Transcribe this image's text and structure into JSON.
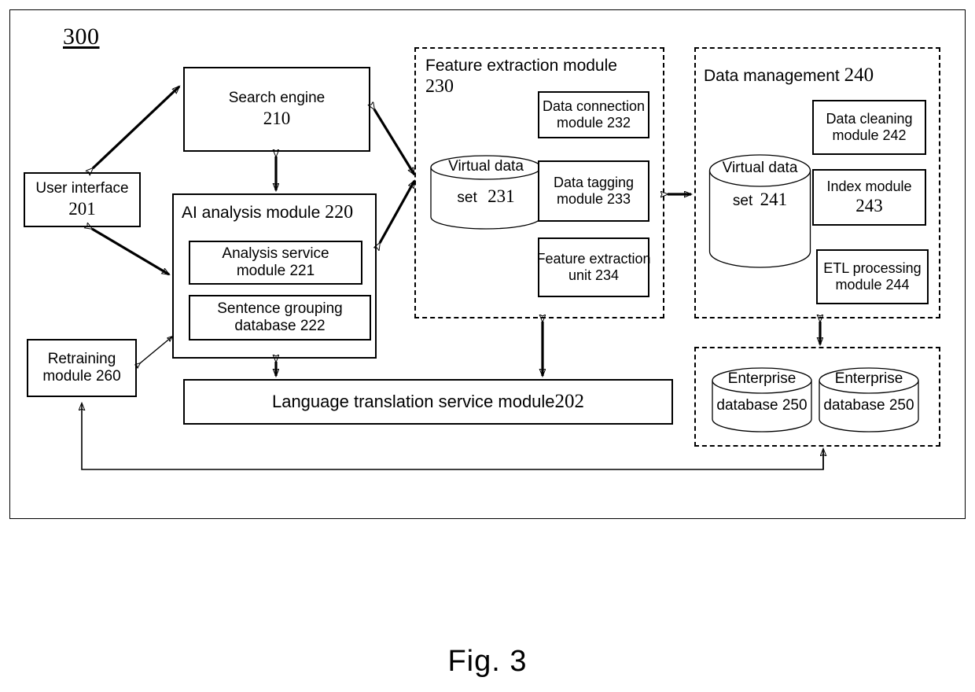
{
  "figure": {
    "id_label": "300",
    "caption": "Fig. 3"
  },
  "blocks": {
    "search_engine": {
      "label": "Search engine",
      "number": "210"
    },
    "user_interface": {
      "label": "User interface",
      "number": "201"
    },
    "ai_analysis": {
      "title": "AI analysis module",
      "number": "220",
      "children": [
        {
          "label_line1": "Analysis service",
          "label_line2": "module 221"
        },
        {
          "label_line1": "Sentence grouping",
          "label_line2": "database 222"
        }
      ]
    },
    "retraining": {
      "label": "Retraining",
      "number": "module 260"
    },
    "language_translation": {
      "label": "Language translation service module",
      "number": "202"
    }
  },
  "groups": {
    "feature_extraction": {
      "title": "Feature extraction module",
      "number": "230",
      "cylinder": {
        "line1": "Virtual data",
        "line2": "set",
        "number": "231"
      },
      "units": [
        {
          "line1": "Data connection",
          "line2": "module 232"
        },
        {
          "line1": "Data tagging",
          "line2": "module 233"
        },
        {
          "line1": "Feature extraction",
          "line2": "unit 234"
        }
      ]
    },
    "data_management": {
      "title": "Data management",
      "number": "240",
      "cylinder": {
        "line1": "Virtual data",
        "line2": "set",
        "number": "241"
      },
      "units": [
        {
          "line1": "Data cleaning",
          "line2": "module 242"
        },
        {
          "line1": "Index module",
          "line2": "243"
        },
        {
          "line1": "ETL processing",
          "line2": "module 244"
        }
      ]
    },
    "enterprise": {
      "databases": [
        {
          "line1": "Enterprise",
          "line2": "database 250"
        },
        {
          "line1": "Enterprise",
          "line2": "database 250"
        }
      ]
    }
  },
  "colors": {
    "stroke": "#000000",
    "background": "#ffffff"
  }
}
